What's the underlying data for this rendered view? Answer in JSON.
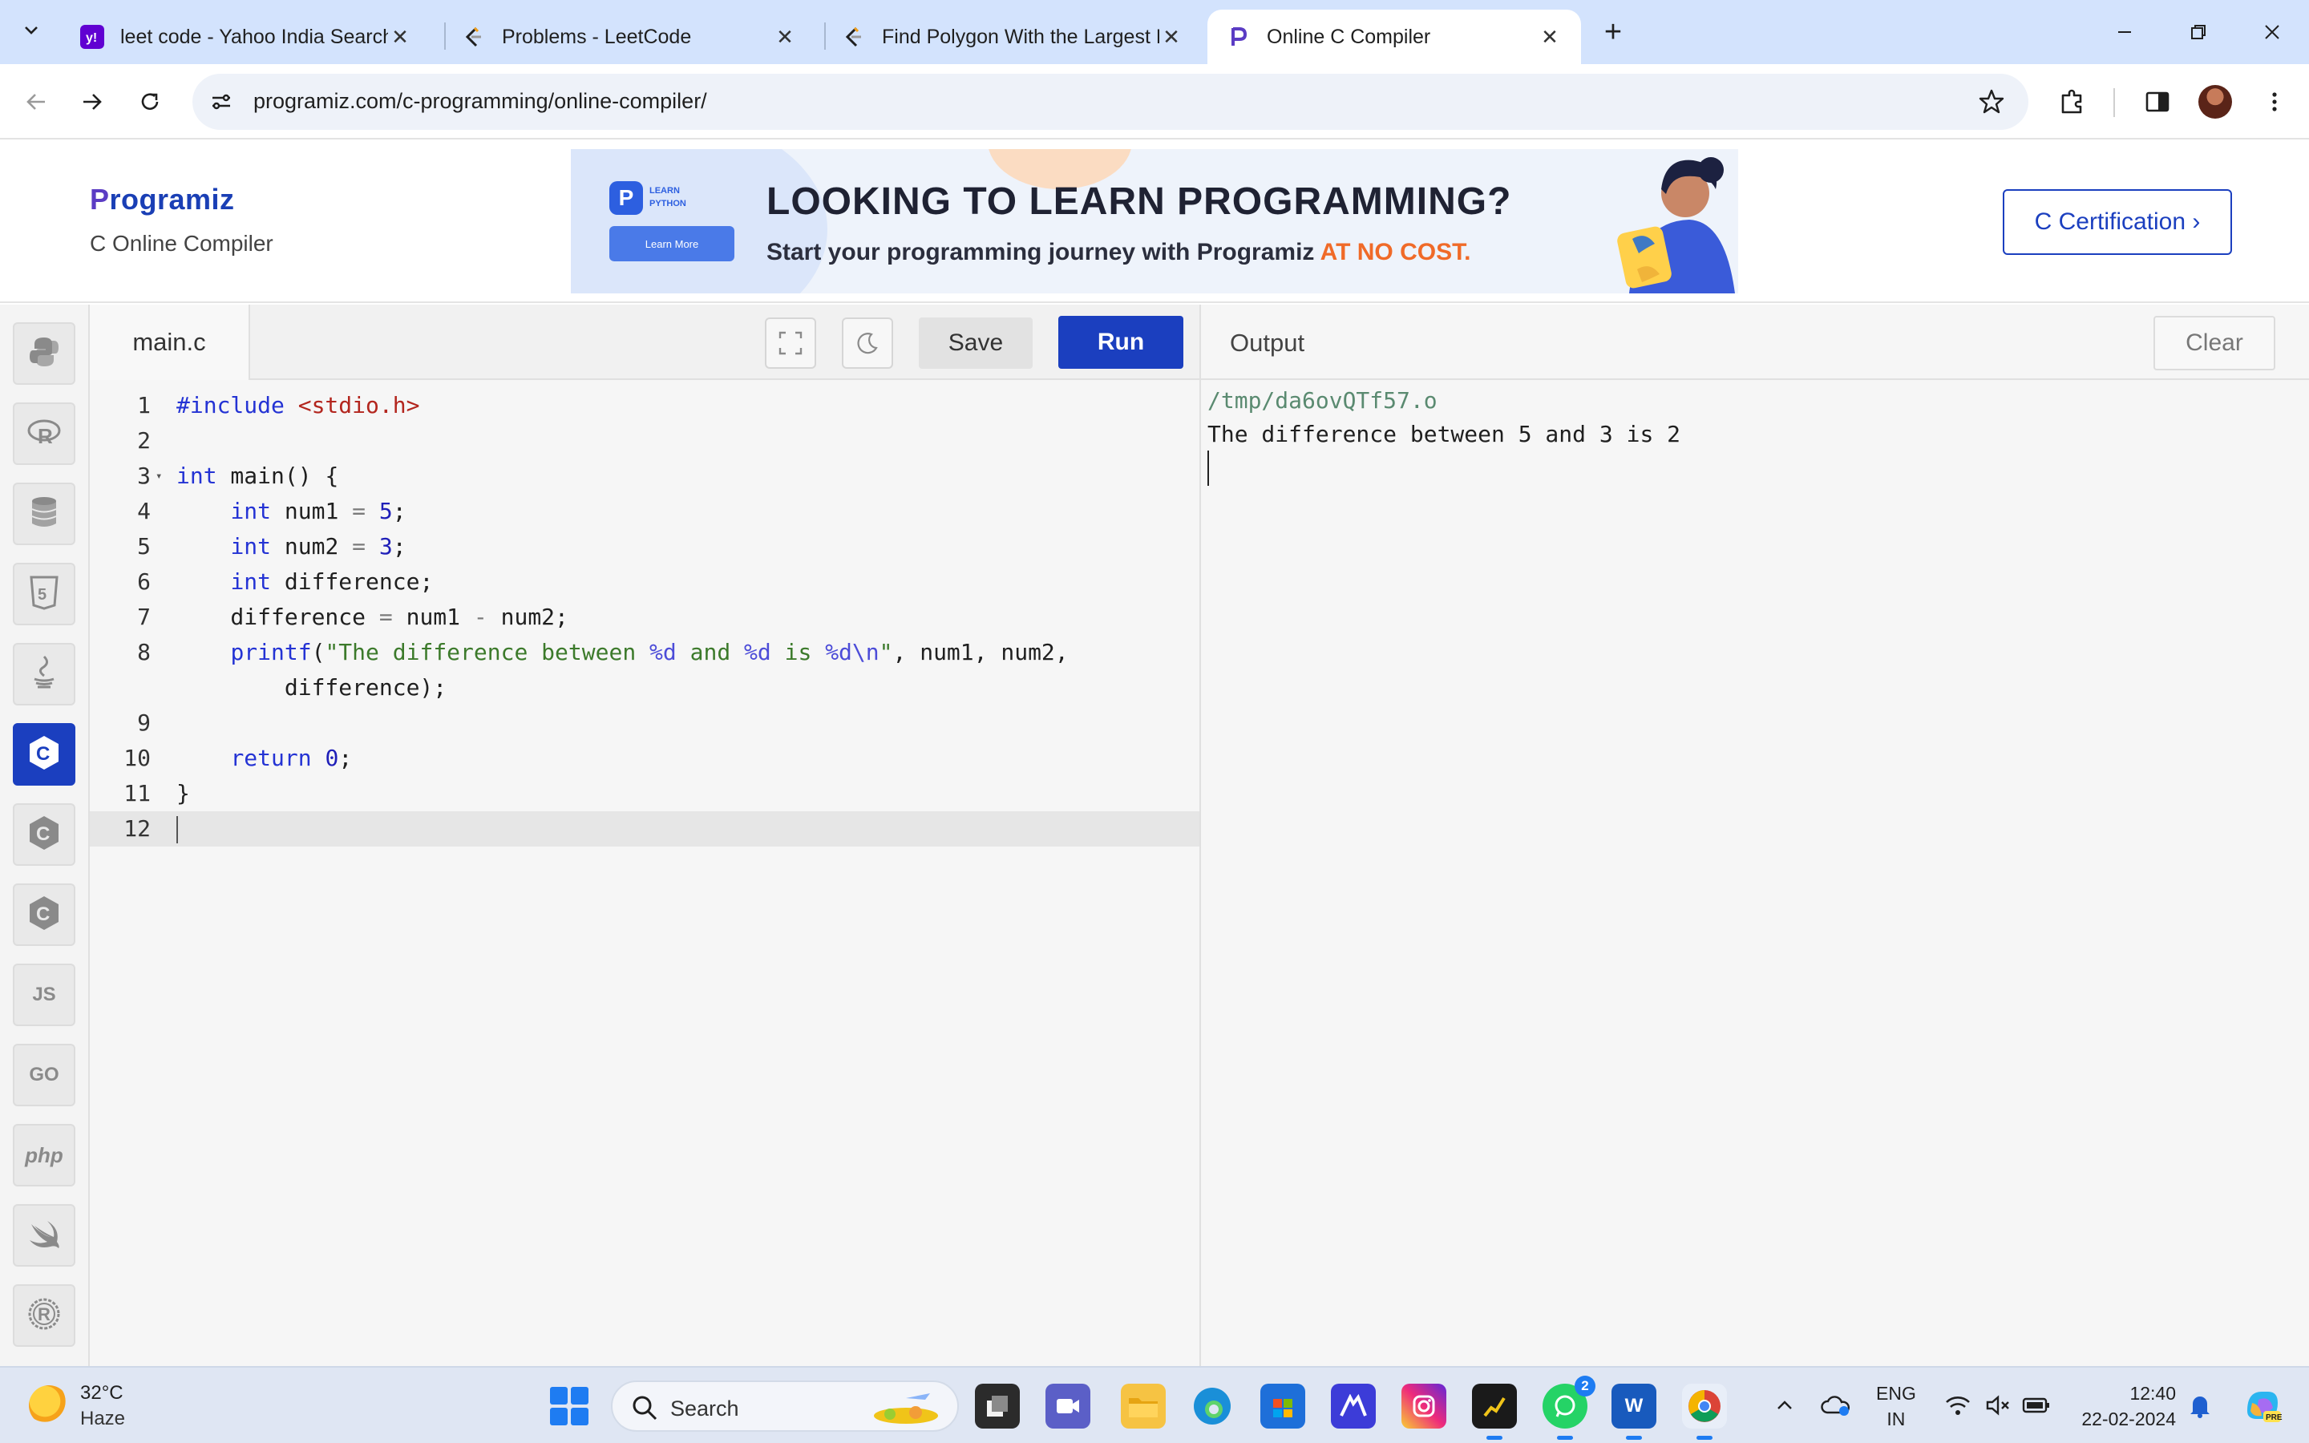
{
  "browser": {
    "tabs": [
      {
        "title": "leet code - Yahoo India Search R",
        "favicon": "yahoo-icon",
        "active": false
      },
      {
        "title": "Problems - LeetCode",
        "favicon": "leetcode-icon",
        "active": false
      },
      {
        "title": "Find Polygon With the Largest P",
        "favicon": "leetcode-icon",
        "active": false
      },
      {
        "title": "Online C Compiler",
        "favicon": "programiz-icon",
        "active": true
      }
    ],
    "url": "programiz.com/c-programming/online-compiler/",
    "colors": {
      "tabstrip": "#d3e3fd",
      "accent": "#1b3fbf"
    }
  },
  "header": {
    "logo": "Programiz",
    "subtitle": "C Online Compiler",
    "certification_button": "C Certification ›",
    "ad": {
      "badge_line1": "LEARN",
      "badge_line2": "PYTHON",
      "cta": "Learn More",
      "headline": "LOOKING TO LEARN PROGRAMMING?",
      "tagline": "Start your programming journey with Programiz",
      "tagline_highlight": "AT NO COST."
    }
  },
  "sidebar": {
    "languages": [
      {
        "name": "python-icon",
        "label": "",
        "active": false
      },
      {
        "name": "r-icon",
        "label": "R",
        "active": false
      },
      {
        "name": "sql-icon",
        "label": "",
        "active": false
      },
      {
        "name": "html5-icon",
        "label": "5",
        "active": false
      },
      {
        "name": "java-icon",
        "label": "",
        "active": false
      },
      {
        "name": "c-icon",
        "label": "C",
        "active": true
      },
      {
        "name": "cpp-icon",
        "label": "C",
        "active": false
      },
      {
        "name": "csharp-icon",
        "label": "C",
        "active": false
      },
      {
        "name": "javascript-icon",
        "label": "JS",
        "active": false
      },
      {
        "name": "go-icon",
        "label": "GO",
        "active": false
      },
      {
        "name": "php-icon",
        "label": "php",
        "active": false
      },
      {
        "name": "swift-icon",
        "label": "",
        "active": false
      },
      {
        "name": "rust-icon",
        "label": "R",
        "active": false
      }
    ]
  },
  "editor": {
    "filename": "main.c",
    "save_label": "Save",
    "run_label": "Run",
    "lines": [
      {
        "n": "1",
        "tokens": [
          {
            "t": "#include ",
            "c": "kw"
          },
          {
            "t": "<stdio.h>",
            "c": "inc"
          }
        ]
      },
      {
        "n": "2",
        "tokens": []
      },
      {
        "n": "3",
        "fold": true,
        "tokens": [
          {
            "t": "int",
            "c": "kw"
          },
          {
            "t": " main() {",
            "c": ""
          }
        ]
      },
      {
        "n": "4",
        "tokens": [
          {
            "t": "    ",
            "c": ""
          },
          {
            "t": "int",
            "c": "kw"
          },
          {
            "t": " num1 ",
            "c": ""
          },
          {
            "t": "=",
            "c": "op"
          },
          {
            "t": " ",
            "c": ""
          },
          {
            "t": "5",
            "c": "num"
          },
          {
            "t": ";",
            "c": ""
          }
        ]
      },
      {
        "n": "5",
        "tokens": [
          {
            "t": "    ",
            "c": ""
          },
          {
            "t": "int",
            "c": "kw"
          },
          {
            "t": " num2 ",
            "c": ""
          },
          {
            "t": "=",
            "c": "op"
          },
          {
            "t": " ",
            "c": ""
          },
          {
            "t": "3",
            "c": "num"
          },
          {
            "t": ";",
            "c": ""
          }
        ]
      },
      {
        "n": "6",
        "tokens": [
          {
            "t": "    ",
            "c": ""
          },
          {
            "t": "int",
            "c": "kw"
          },
          {
            "t": " difference;",
            "c": ""
          }
        ]
      },
      {
        "n": "7",
        "tokens": [
          {
            "t": "    difference ",
            "c": ""
          },
          {
            "t": "=",
            "c": "op"
          },
          {
            "t": " num1 ",
            "c": ""
          },
          {
            "t": "-",
            "c": "op"
          },
          {
            "t": " num2;",
            "c": ""
          }
        ]
      },
      {
        "n": "8",
        "tokens": [
          {
            "t": "    ",
            "c": ""
          },
          {
            "t": "printf",
            "c": "kw"
          },
          {
            "t": "(",
            "c": ""
          },
          {
            "t": "\"The difference between ",
            "c": "str"
          },
          {
            "t": "%d",
            "c": "fmt"
          },
          {
            "t": " and ",
            "c": "str"
          },
          {
            "t": "%d",
            "c": "fmt"
          },
          {
            "t": " is ",
            "c": "str"
          },
          {
            "t": "%d\\n",
            "c": "fmt"
          },
          {
            "t": "\"",
            "c": "str"
          },
          {
            "t": ", num1, num2,",
            "c": ""
          }
        ]
      },
      {
        "n": "",
        "tokens": [
          {
            "t": "        difference);",
            "c": ""
          }
        ]
      },
      {
        "n": "9",
        "tokens": []
      },
      {
        "n": "10",
        "tokens": [
          {
            "t": "    ",
            "c": ""
          },
          {
            "t": "return",
            "c": "kw"
          },
          {
            "t": " ",
            "c": ""
          },
          {
            "t": "0",
            "c": "num"
          },
          {
            "t": ";",
            "c": ""
          }
        ]
      },
      {
        "n": "11",
        "tokens": [
          {
            "t": "}",
            "c": ""
          }
        ]
      },
      {
        "n": "12",
        "current": true,
        "tokens": []
      }
    ]
  },
  "output": {
    "title": "Output",
    "clear_label": "Clear",
    "path_line": "/tmp/da6ovQTf57.o",
    "result_line": "The difference between 5 and 3 is 2"
  },
  "taskbar": {
    "weather_temp": "32°C",
    "weather_cond": "Haze",
    "search_label": "Search",
    "whatsapp_badge": "2",
    "lang_line1": "ENG",
    "lang_line2": "IN",
    "time": "12:40",
    "date": "22-02-2024"
  }
}
